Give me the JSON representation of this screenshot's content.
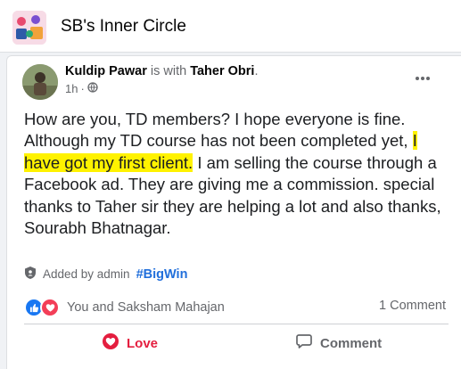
{
  "group": {
    "name": "SB's Inner Circle"
  },
  "post": {
    "author": "Kuldip Pawar",
    "with_text": " is with ",
    "tagged": "Taher Obri",
    "tagged_suffix": ".",
    "time": "1h",
    "separator": " · ",
    "privacy_icon": "globe-icon",
    "more_icon": "more-dots-icon",
    "body_before": "How are you, TD members? I hope everyone is fine. Although my TD course has not been completed yet, ",
    "body_highlight": "I have got my first client.",
    "body_after": " I am selling the course through a Facebook ad. They are giving me a commission. special thanks to Taher sir they are helping a lot and also thanks, Sourabh Bhatnagar.",
    "highlight_color": "#fff200"
  },
  "added_by": {
    "icon": "shield-icon",
    "text": "Added by admin",
    "hashtag": "#BigWin"
  },
  "reactions": {
    "icons": [
      "like-icon",
      "love-icon"
    ],
    "names": "You and Saksham Mahajan",
    "comment_count": "1 Comment"
  },
  "actions": {
    "love_label": "Love",
    "comment_label": "Comment"
  },
  "colors": {
    "love": "#e41e3f",
    "like": "#1877f2",
    "hashtag": "#216fdb",
    "muted": "#65676b"
  }
}
